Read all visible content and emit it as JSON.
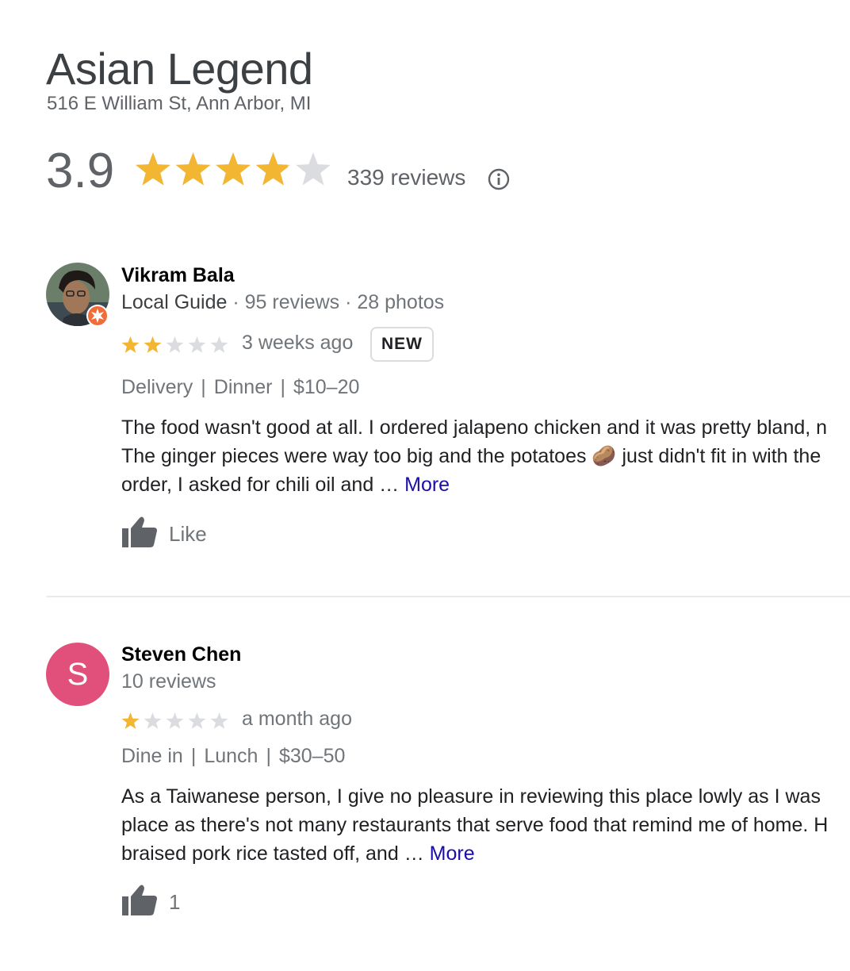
{
  "place": {
    "name": "Asian Legend",
    "address": "516 E William St, Ann Arbor, MI",
    "rating": "3.9",
    "rating_value": 3.9,
    "review_count": "339 reviews"
  },
  "colors": {
    "star_filled": "#f2b632",
    "star_empty": "#dadce0",
    "link": "#1a0dab",
    "avatar_s": "#e0507a"
  },
  "reviews": [
    {
      "name": "Vikram Bala",
      "guide": "Local Guide",
      "meta": " · 95 reviews · 28 photos",
      "stars": 2,
      "time": "3 weeks ago",
      "badge": "NEW",
      "tags": [
        "Delivery",
        "Dinner",
        "$10–20"
      ],
      "text_lines": [
        "The food wasn't good at all. I ordered jalapeno chicken and it was pretty bland, n",
        "The ginger pieces were way too big and the potatoes 🥔 just didn't fit in with the",
        "order, I asked for chili oil and … "
      ],
      "more": "More",
      "like_label": "Like",
      "avatar_icon": "local-guide-badge-icon"
    },
    {
      "name": "Steven Chen",
      "meta": "10 reviews",
      "avatar_letter": "S",
      "stars": 1,
      "time": "a month ago",
      "tags": [
        "Dine in",
        "Lunch",
        "$30–50"
      ],
      "text_lines": [
        "As a Taiwanese person, I give no pleasure in reviewing this place lowly as I was",
        "place as there's not many restaurants that serve food that remind me of home. H",
        "braised pork rice tasted off, and … "
      ],
      "more": "More",
      "like_label": "1"
    }
  ]
}
